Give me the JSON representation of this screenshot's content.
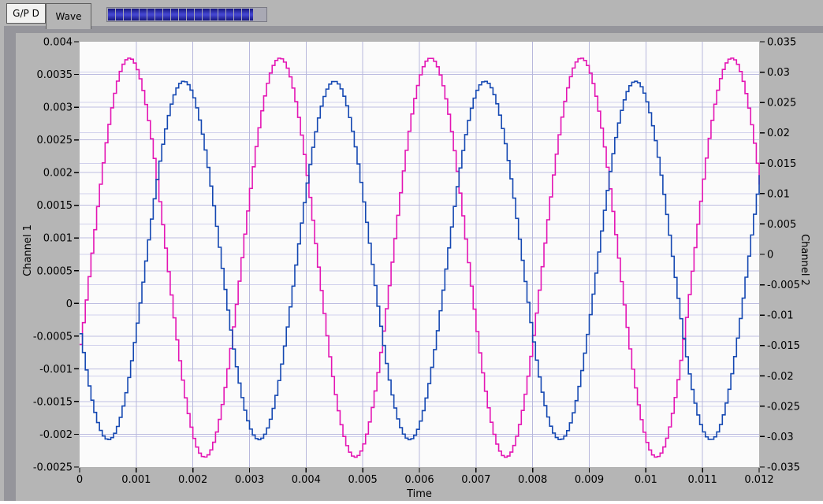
{
  "tabs": [
    {
      "label": "G/P D",
      "selected": false
    },
    {
      "label": "Wave",
      "selected": true
    }
  ],
  "progress": {
    "segments": 19,
    "fill_percent": 100,
    "colors": {
      "segment_dark": "#15157e",
      "segment_bright": "#4345cf",
      "track": "#a9a9b4"
    }
  },
  "colors": {
    "window_chrome": "#b5b5b5",
    "panel_background": "#95959b",
    "plot_background": "#fbfbfb",
    "grid_left_axis": "#bcbce0",
    "grid_right_axis": "#d0d0ec",
    "grid_vertical": "#b8b8dc",
    "channel1_trace": "#e416b4",
    "channel2_trace": "#1548b2"
  },
  "chart_data": {
    "type": "line",
    "title": "",
    "xlabel": "Time",
    "x_range": [
      0,
      0.012
    ],
    "x_tick_labels": [
      "0",
      "0.001",
      "0.002",
      "0.003",
      "0.004",
      "0.005",
      "0.006",
      "0.007",
      "0.008",
      "0.009",
      "0.01",
      "0.011",
      "0.012"
    ],
    "y_left": {
      "label": "Channel 1",
      "range": [
        -0.0025,
        0.004
      ],
      "tick_labels": [
        "0.004",
        "0.0035",
        "0.003",
        "0.0025",
        "0.002",
        "0.0015",
        "0.001",
        "0.0005",
        "0",
        "-0.0005",
        "-0.001",
        "-0.0015",
        "-0.002",
        "-0.0025"
      ]
    },
    "y_right": {
      "label": "Channel 2",
      "range": [
        -0.035,
        0.035
      ],
      "tick_labels": [
        "0.035",
        "0.03",
        "0.025",
        "0.02",
        "0.015",
        "0.01",
        "0.005",
        "0",
        "-0.005",
        "-0.01",
        "-0.015",
        "-0.02",
        "-0.025",
        "-0.03",
        "-0.035"
      ]
    },
    "grid": true,
    "legend": "none",
    "render_style": "stepped-samples",
    "sample_step_s": 5e-05,
    "series": [
      {
        "name": "Channel 1",
        "axis": "left",
        "color": "#e416b4",
        "model": "sine",
        "frequency_hz": 376,
        "amplitude": 0.00305,
        "offset": 0.0007,
        "phase_rad": -0.45,
        "approx_peak": 0.00375,
        "approx_trough": -0.00235,
        "value_at_t0": -0.0005
      },
      {
        "name": "Channel 2",
        "axis": "right",
        "color": "#1548b2",
        "model": "sine",
        "frequency_hz": 376,
        "amplitude": 0.0295,
        "offset": -0.001,
        "phase_rad": -2.72,
        "approx_peak": 0.0285,
        "approx_trough": -0.0305,
        "value_at_t0": -0.014
      }
    ]
  }
}
